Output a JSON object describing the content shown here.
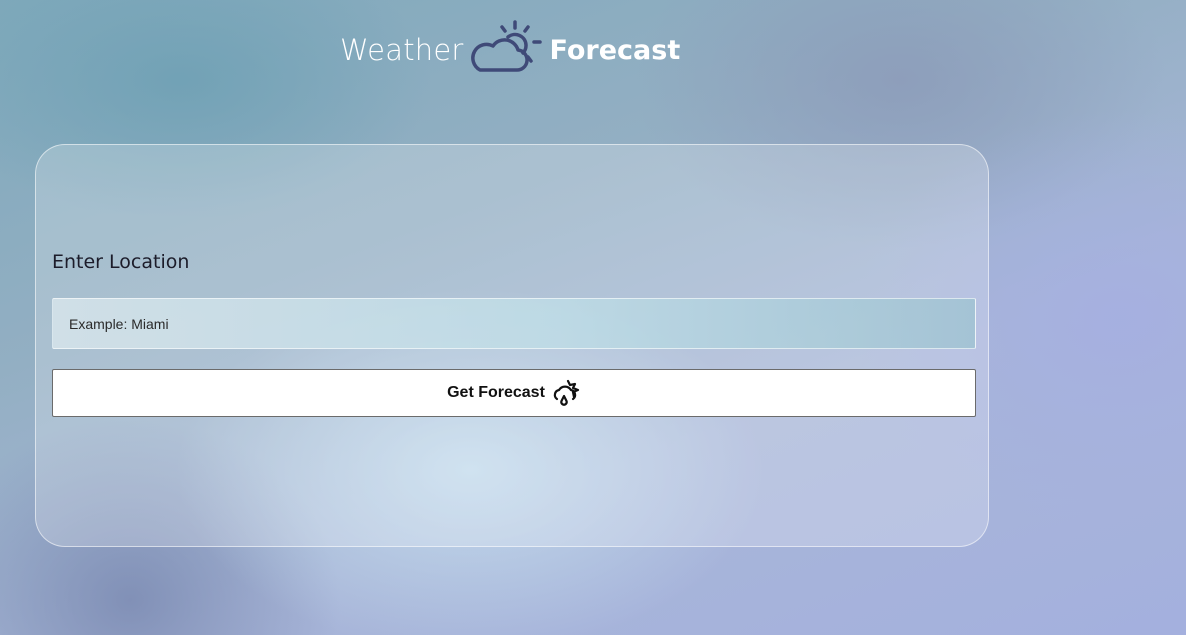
{
  "header": {
    "title_light": "Weather",
    "title_bold": "Forecast",
    "logo_icon": "cloud-sun-icon"
  },
  "form": {
    "label": "Enter Location",
    "input_placeholder": "Example: Miami",
    "input_value": "",
    "button_label": "Get Forecast",
    "button_icon": "cloud-rain-moon-icon"
  },
  "colors": {
    "logo_text": "#ffffff",
    "logo_icon": "#3f4a78",
    "button_bg": "#ffffff",
    "label_text": "#1c1c2a"
  }
}
